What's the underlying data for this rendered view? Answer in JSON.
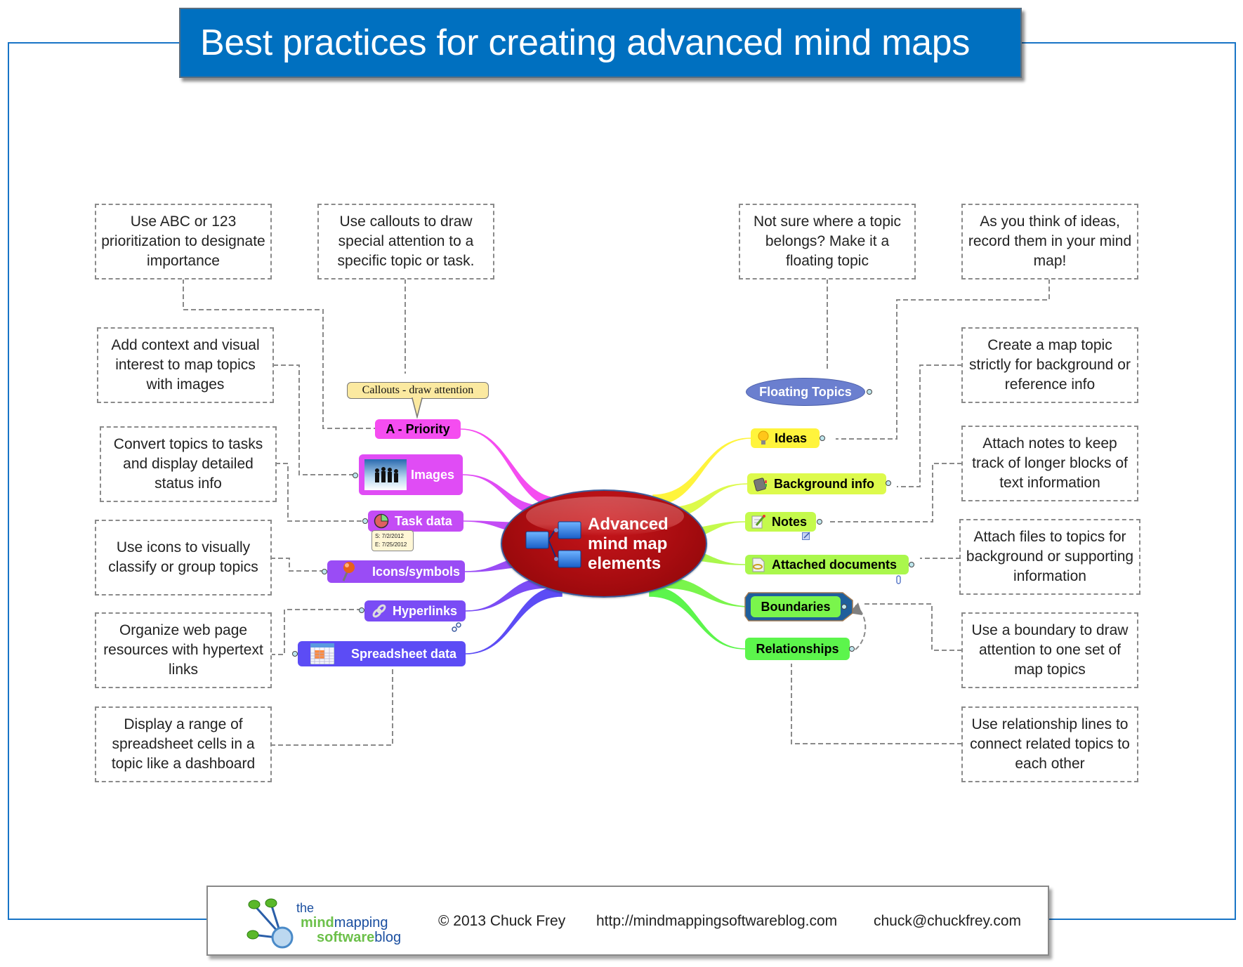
{
  "title": "Best practices for creating advanced mind maps",
  "central_topic": {
    "lines": [
      "Advanced",
      "mind map",
      "elements"
    ],
    "color": "#b00c10"
  },
  "callout": {
    "text": "Callouts - draw attention"
  },
  "left_topics": [
    {
      "id": "priority",
      "label": "A - Priority",
      "color": "#f54df0",
      "text_color": "#000000",
      "icon": "none"
    },
    {
      "id": "images",
      "label": "Images",
      "color": "#e04cf5",
      "text_color": "#ffffff",
      "icon": "people-image-icon"
    },
    {
      "id": "task-data",
      "label": "Task data",
      "color": "#c44cf5",
      "text_color": "#ffffff",
      "icon": "progress-pie-icon"
    },
    {
      "id": "icons",
      "label": "Icons/symbols",
      "color": "#9a4cf5",
      "text_color": "#ffffff",
      "icon": "pushpin-icon"
    },
    {
      "id": "hyperlinks",
      "label": "Hyperlinks",
      "color": "#7a4cf5",
      "text_color": "#ffffff",
      "icon": "chain-link-icon"
    },
    {
      "id": "spreadsheet",
      "label": "Spreadsheet data",
      "color": "#5c4cf5",
      "text_color": "#ffffff",
      "icon": "spreadsheet-icon"
    }
  ],
  "task_dates": {
    "start": "S: 7/2/2012",
    "end": "E: 7/25/2012"
  },
  "right_topics": [
    {
      "id": "floating",
      "label": "Floating Topics",
      "color": "#6b7fcf",
      "text_color": "#ffffff",
      "icon": "none"
    },
    {
      "id": "ideas",
      "label": "Ideas",
      "color": "#fff43c",
      "text_color": "#000000",
      "icon": "lightbulb-icon"
    },
    {
      "id": "background",
      "label": "Background info",
      "color": "#ddfa4c",
      "text_color": "#000000",
      "icon": "book-icon"
    },
    {
      "id": "notes",
      "label": "Notes",
      "color": "#c4fa4c",
      "text_color": "#000000",
      "icon": "notepad-icon"
    },
    {
      "id": "attached",
      "label": "Attached documents",
      "color": "#aaf74c",
      "text_color": "#000000",
      "icon": "document-icon"
    },
    {
      "id": "boundaries",
      "label": "Boundaries",
      "color": "#7af54c",
      "text_color": "#000000",
      "icon": "none"
    },
    {
      "id": "relationships",
      "label": "Relationships",
      "color": "#5cf54c",
      "text_color": "#000000",
      "icon": "none"
    }
  ],
  "left_notes": [
    "Use ABC or 123 prioritization to designate importance",
    "Use callouts to draw special attention to a specific topic or task.",
    "Add context and visual interest to map topics with images",
    "Convert topics to tasks and display detailed status info",
    "Use icons to visually classify or group topics",
    "Organize web page resources with hypertext links",
    "Display a range of spreadsheet cells in a topic like a dashboard"
  ],
  "right_notes": [
    "Not sure where a topic belongs? Make it a floating topic",
    "As you think of ideas, record them in your mind map!",
    "Create a map topic strictly for background or reference info",
    "Attach notes to keep track of longer blocks of text information",
    "Attach files to topics for background or supporting information",
    "Use a boundary to draw attention to one set of map topics",
    "Use relationship lines to connect related topics to each other"
  ],
  "footer": {
    "logo": {
      "line1": "the",
      "line2_bold": "mind",
      "line2_rest": "mapping",
      "line3_bold": "software",
      "line3_rest": "blog"
    },
    "copyright": "© 2013 Chuck Frey",
    "url": "http://mindmappingsoftwareblog.com",
    "email": "chuck@chuckfrey.com"
  },
  "colors": {
    "accent_blue": "#0070c0",
    "frame_blue": "#1874c6",
    "dashed_gray": "#8a8a8a",
    "boundary_blue": "#1f5f9c"
  }
}
